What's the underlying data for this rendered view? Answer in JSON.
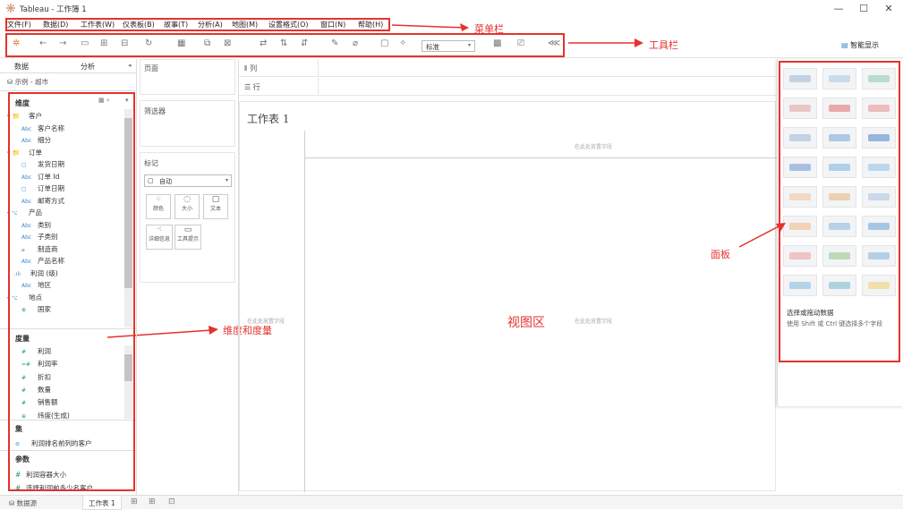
{
  "window": {
    "title": "Tableau - 工作簿 1",
    "minimize": "—",
    "maximize": "☐",
    "close": "✕"
  },
  "menu": {
    "items": [
      "文件(F)",
      "数据(D)",
      "工作表(W)",
      "仪表板(B)",
      "故事(T)",
      "分析(A)",
      "地图(M)",
      "设置格式(O)",
      "窗口(N)",
      "帮助(H)"
    ]
  },
  "toolbar": {
    "fit_select": "标准",
    "smart_display": "智能显示"
  },
  "sidebar": {
    "tabs": [
      "数据",
      "分析"
    ],
    "datasource": "示例 - 超市",
    "dimensions_header": "维度",
    "dimension_fields": [
      {
        "type": "folder",
        "name": "客户"
      },
      {
        "type": "Abc",
        "name": "客户名称"
      },
      {
        "type": "Abc",
        "name": "细分"
      },
      {
        "type": "folder",
        "name": "订单"
      },
      {
        "type": "date",
        "name": "发货日期"
      },
      {
        "type": "Abc",
        "name": "订单 Id"
      },
      {
        "type": "date",
        "name": "订单日期"
      },
      {
        "type": "Abc",
        "name": "邮寄方式"
      },
      {
        "type": "hier",
        "name": "产品"
      },
      {
        "type": "Abc",
        "name": "类别"
      },
      {
        "type": "Abc",
        "name": "子类别"
      },
      {
        "type": "link",
        "name": "制造商"
      },
      {
        "type": "Abc",
        "name": "产品名称"
      },
      {
        "type": "bin",
        "name": "利润 (级)"
      },
      {
        "type": "Abc",
        "name": "地区"
      },
      {
        "type": "hier",
        "name": "地点"
      },
      {
        "type": "geo",
        "name": "国家"
      }
    ],
    "measures_header": "度量",
    "measure_fields": [
      {
        "type": "#",
        "name": "利润"
      },
      {
        "type": "=#",
        "name": "利润率"
      },
      {
        "type": "#",
        "name": "折扣"
      },
      {
        "type": "#",
        "name": "数量"
      },
      {
        "type": "#",
        "name": "销售额"
      },
      {
        "type": "geo",
        "name": "纬度(生成)"
      }
    ],
    "sets_header": "集",
    "set_fields": [
      {
        "name": "利润排名前列的客户"
      }
    ],
    "params_header": "参数",
    "param_fields": [
      {
        "type": "#",
        "name": "利润容器大小"
      },
      {
        "type": "#",
        "name": "选择利润前多少名客户"
      }
    ]
  },
  "shelves": {
    "pages": "页面",
    "filters": "筛选器",
    "marks": "标记",
    "mark_type": "自动",
    "columns": "列",
    "rows": "行"
  },
  "mark_buttons": [
    "颜色",
    "大小",
    "文本",
    "详细信息",
    "工具提示"
  ],
  "view": {
    "sheet_title": "工作表 1",
    "drop_top": "在此处放置字段",
    "drop_left": "在此处放置字段",
    "drop_center": "在此处放置字段"
  },
  "showme": {
    "prompt_title": "选择或拖动数据",
    "prompt_body": "使用 Shift 或 Ctrl 键选择多个字段"
  },
  "annotations": {
    "menubar": "菜单栏",
    "toolbar": "工具栏",
    "dims": "维度和度量",
    "panel": "面板",
    "view": "视图区"
  },
  "bottom": {
    "datasource": "数据源",
    "sheet_tab": "工作表 1"
  },
  "colors": {
    "accent_red": "#e5322d",
    "tableau_blue": "#3a86c8"
  }
}
